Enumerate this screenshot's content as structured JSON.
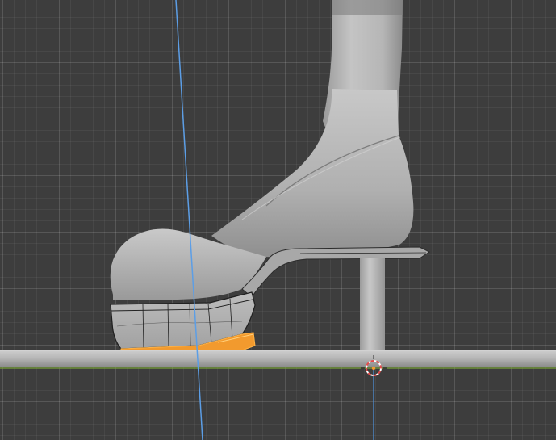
{
  "viewport": {
    "view": "3d-viewport",
    "colors": {
      "background": "#3d3d3d",
      "model": "#b4b4b4",
      "selection": "#f29a2e",
      "axis_x": "#7aa33a",
      "axis_z": "#4f8fd6",
      "cursor": "#e34b4b"
    },
    "objects": [
      {
        "name": "leg",
        "icon": "mesh-icon"
      },
      {
        "name": "shoe-upper",
        "icon": "mesh-icon"
      },
      {
        "name": "platform-sole",
        "icon": "mesh-icon"
      },
      {
        "name": "heel",
        "icon": "mesh-icon"
      },
      {
        "name": "ground-bar",
        "icon": "mesh-icon"
      }
    ],
    "cursor_icon": "3d-cursor-icon"
  }
}
